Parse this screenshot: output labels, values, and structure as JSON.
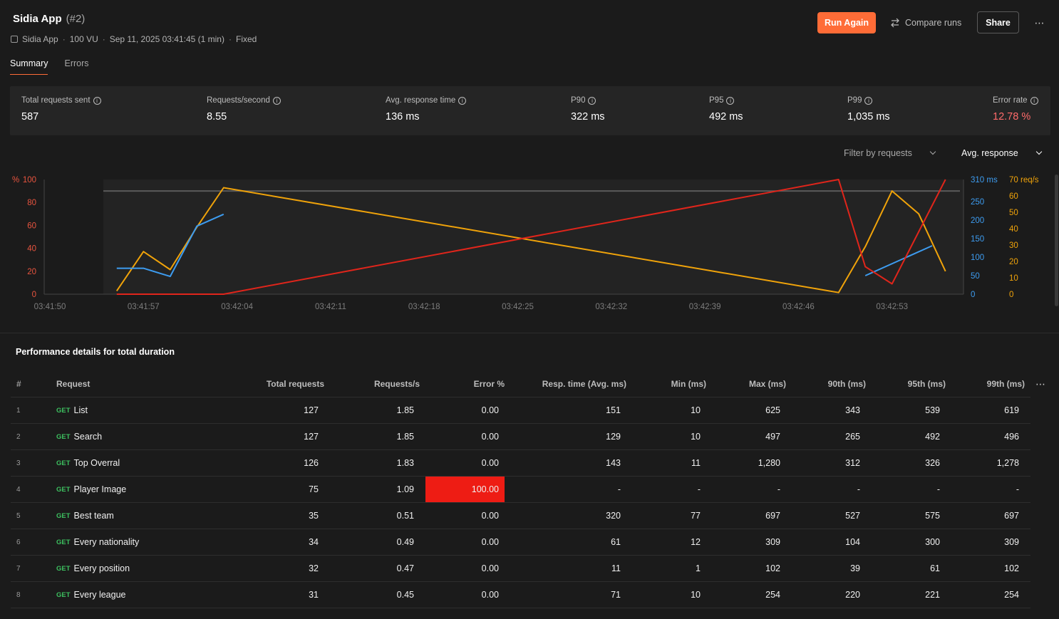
{
  "header": {
    "title": "Sidia App",
    "run_number": "(#2)",
    "meta": {
      "collection": "Sidia App",
      "virtual_users": "100 VU",
      "started": "Sep 11, 2025 03:41:45 (1 min)",
      "load_profile": "Fixed"
    },
    "run_again_label": "Run Again",
    "compare_label": "Compare runs",
    "share_label": "Share",
    "more_label": "⋯"
  },
  "tabs": [
    {
      "label": "Summary",
      "active": true
    },
    {
      "label": "Errors",
      "active": false
    }
  ],
  "stats": [
    {
      "label": "Total requests sent",
      "value": "587"
    },
    {
      "label": "Requests/second",
      "value": "8.55"
    },
    {
      "label": "Avg. response time",
      "value": "136 ms"
    },
    {
      "label": "P90",
      "value": "322 ms"
    },
    {
      "label": "P95",
      "value": "492 ms"
    },
    {
      "label": "P99",
      "value": "1,035 ms"
    },
    {
      "label": "Error rate",
      "value": "12.78 %"
    }
  ],
  "filters": {
    "requests_label": "Filter by requests",
    "metric_label": "Avg. response"
  },
  "chart_data": {
    "type": "line",
    "x_ticks": [
      "03:41:50",
      "03:41:57",
      "03:42:04",
      "03:42:11",
      "03:42:18",
      "03:42:25",
      "03:42:32",
      "03:42:39",
      "03:42:46",
      "03:42:53"
    ],
    "left_axis": {
      "label": "%",
      "ticks": [
        "100",
        "80",
        "60",
        "40",
        "20",
        "0"
      ],
      "ylim": [
        0,
        100
      ],
      "color": "#e8543f"
    },
    "right_axis_ms": {
      "unit": "ms",
      "ticks": [
        "310 ms",
        "250",
        "200",
        "150",
        "100",
        "50",
        "0"
      ],
      "ylim": [
        0,
        310
      ],
      "color": "#3d9cf0"
    },
    "right_axis_req": {
      "unit": "req/s",
      "ticks": [
        "70 req/s",
        "60",
        "50",
        "40",
        "30",
        "20",
        "10",
        "0"
      ],
      "ylim": [
        0,
        70
      ],
      "color": "#f0a30a"
    },
    "series": [
      {
        "axis": "req",
        "color": "#f0a30a",
        "x": [
          "03:41:55",
          "03:41:57",
          "03:41:59",
          "03:42:01",
          "03:42:03",
          "03:42:49",
          "03:42:51",
          "03:42:53",
          "03:42:55",
          "03:42:57"
        ],
        "values": [
          2,
          26,
          15,
          41,
          65,
          1,
          29,
          63,
          49,
          14
        ]
      },
      {
        "axis": "ms",
        "color": "#3d9cf0",
        "x": [
          "03:41:55",
          "03:41:57",
          "03:41:59",
          "03:42:01",
          "03:42:03",
          "03:42:51",
          "03:42:56"
        ],
        "values": [
          70,
          70,
          48,
          184,
          216,
          50,
          131
        ]
      },
      {
        "axis": "pct",
        "color": "#e0251b",
        "x": [
          "03:41:55",
          "03:42:03",
          "03:42:49",
          "03:42:51",
          "03:42:53",
          "03:42:57"
        ],
        "values": [
          0,
          0,
          100,
          24,
          9,
          100
        ]
      }
    ],
    "reference_line": {
      "axis": "req",
      "value": 63
    }
  },
  "details": {
    "title": "Performance details for total duration",
    "columns": [
      "#",
      "Request",
      "Total requests",
      "Requests/s",
      "Error %",
      "Resp. time (Avg. ms)",
      "Min (ms)",
      "Max (ms)",
      "90th (ms)",
      "95th (ms)",
      "99th (ms)"
    ],
    "more_label": "⋯",
    "rows": [
      {
        "idx": "1",
        "method": "GET",
        "name": "List",
        "total": "127",
        "rps": "1.85",
        "err": "0.00",
        "avg": "151",
        "min": "10",
        "max": "625",
        "p90": "343",
        "p95": "539",
        "p99": "619"
      },
      {
        "idx": "2",
        "method": "GET",
        "name": "Search",
        "total": "127",
        "rps": "1.85",
        "err": "0.00",
        "avg": "129",
        "min": "10",
        "max": "497",
        "p90": "265",
        "p95": "492",
        "p99": "496"
      },
      {
        "idx": "3",
        "method": "GET",
        "name": "Top Overral",
        "total": "126",
        "rps": "1.83",
        "err": "0.00",
        "avg": "143",
        "min": "11",
        "max": "1,280",
        "p90": "312",
        "p95": "326",
        "p99": "1,278"
      },
      {
        "idx": "4",
        "method": "GET",
        "name": "Player Image",
        "total": "75",
        "rps": "1.09",
        "err": "100.00",
        "avg": "-",
        "min": "-",
        "max": "-",
        "p90": "-",
        "p95": "-",
        "p99": "-"
      },
      {
        "idx": "5",
        "method": "GET",
        "name": "Best team",
        "total": "35",
        "rps": "0.51",
        "err": "0.00",
        "avg": "320",
        "min": "77",
        "max": "697",
        "p90": "527",
        "p95": "575",
        "p99": "697"
      },
      {
        "idx": "6",
        "method": "GET",
        "name": "Every nationality",
        "total": "34",
        "rps": "0.49",
        "err": "0.00",
        "avg": "61",
        "min": "12",
        "max": "309",
        "p90": "104",
        "p95": "300",
        "p99": "309"
      },
      {
        "idx": "7",
        "method": "GET",
        "name": "Every position",
        "total": "32",
        "rps": "0.47",
        "err": "0.00",
        "avg": "11",
        "min": "1",
        "max": "102",
        "p90": "39",
        "p95": "61",
        "p99": "102"
      },
      {
        "idx": "8",
        "method": "GET",
        "name": "Every league",
        "total": "31",
        "rps": "0.45",
        "err": "0.00",
        "avg": "71",
        "min": "10",
        "max": "254",
        "p90": "220",
        "p95": "221",
        "p99": "254"
      }
    ]
  }
}
